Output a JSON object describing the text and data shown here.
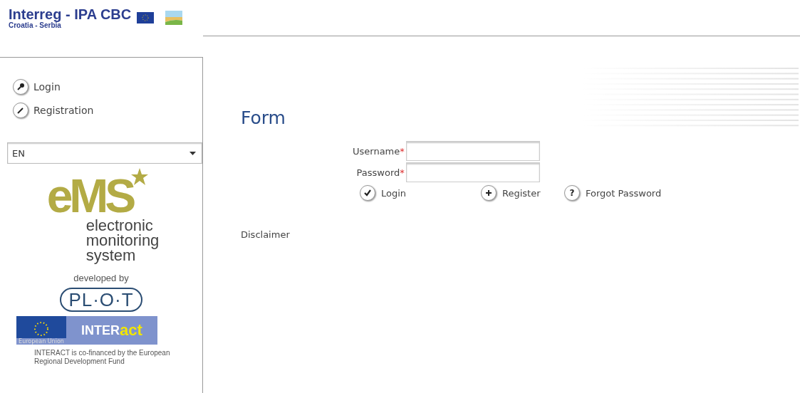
{
  "header": {
    "title": "Interreg - IPA CBC",
    "subtitle": "Croatia - Serbia"
  },
  "sidebar": {
    "nav": [
      {
        "label": "Login",
        "kind": "key"
      },
      {
        "label": "Registration",
        "kind": "pencil"
      }
    ],
    "language": {
      "value": "EN"
    },
    "ems_logo": {
      "mark": "eMS",
      "tagline": [
        "electronic",
        "monitoring",
        "system"
      ]
    },
    "developer": {
      "label": "developed by",
      "name": "PL·O·T"
    },
    "interact": {
      "flag_label": "European Union",
      "name_start": "INTER",
      "name_end": "act"
    },
    "cofinance": "INTERACT is co-financed by the European Regional Development Fund"
  },
  "main": {
    "title": "Form",
    "fields": [
      {
        "label": "Username",
        "marker": "*"
      },
      {
        "label": "Password",
        "marker": "*"
      }
    ],
    "actions": [
      {
        "label": "Login",
        "kind": "check"
      },
      {
        "label": "Register",
        "kind": "plus"
      },
      {
        "label": "Forgot Password",
        "kind": "help",
        "glyph": "?"
      }
    ],
    "disclaimer": "Disclaimer"
  }
}
